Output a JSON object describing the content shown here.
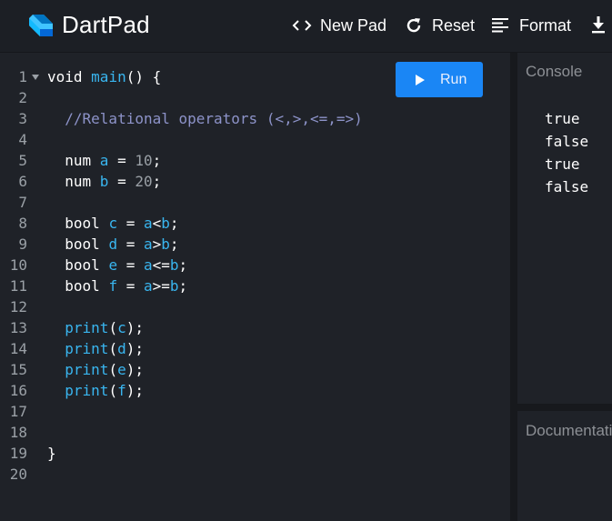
{
  "header": {
    "app_title": "DartPad",
    "toolbar": {
      "new_pad_label": "New Pad",
      "reset_label": "Reset",
      "format_label": "Format"
    }
  },
  "editor": {
    "run_label": "Run",
    "line_numbers": [
      "1",
      "2",
      "3",
      "4",
      "5",
      "6",
      "7",
      "8",
      "9",
      "10",
      "11",
      "12",
      "13",
      "14",
      "15",
      "16",
      "17",
      "18",
      "19",
      "20"
    ],
    "lines": [
      [
        {
          "t": "void ",
          "c": "kw"
        },
        {
          "t": "main",
          "c": "fn"
        },
        {
          "t": "() {",
          "c": "pl"
        }
      ],
      [],
      [
        {
          "t": "  //Relational operators (<,>,<=,=>)",
          "c": "cm"
        }
      ],
      [],
      [
        {
          "t": "  num ",
          "c": "kw"
        },
        {
          "t": "a",
          "c": "var"
        },
        {
          "t": " = ",
          "c": "pl"
        },
        {
          "t": "10",
          "c": "num"
        },
        {
          "t": ";",
          "c": "pl"
        }
      ],
      [
        {
          "t": "  num ",
          "c": "kw"
        },
        {
          "t": "b",
          "c": "var"
        },
        {
          "t": " = ",
          "c": "pl"
        },
        {
          "t": "20",
          "c": "num"
        },
        {
          "t": ";",
          "c": "pl"
        }
      ],
      [],
      [
        {
          "t": "  bool ",
          "c": "kw"
        },
        {
          "t": "c",
          "c": "var"
        },
        {
          "t": " = ",
          "c": "pl"
        },
        {
          "t": "a",
          "c": "var"
        },
        {
          "t": "<",
          "c": "pl"
        },
        {
          "t": "b",
          "c": "var"
        },
        {
          "t": ";",
          "c": "pl"
        }
      ],
      [
        {
          "t": "  bool ",
          "c": "kw"
        },
        {
          "t": "d",
          "c": "var"
        },
        {
          "t": " = ",
          "c": "pl"
        },
        {
          "t": "a",
          "c": "var"
        },
        {
          "t": ">",
          "c": "pl"
        },
        {
          "t": "b",
          "c": "var"
        },
        {
          "t": ";",
          "c": "pl"
        }
      ],
      [
        {
          "t": "  bool ",
          "c": "kw"
        },
        {
          "t": "e",
          "c": "var"
        },
        {
          "t": " = ",
          "c": "pl"
        },
        {
          "t": "a",
          "c": "var"
        },
        {
          "t": "<=",
          "c": "pl"
        },
        {
          "t": "b",
          "c": "var"
        },
        {
          "t": ";",
          "c": "pl"
        }
      ],
      [
        {
          "t": "  bool ",
          "c": "kw"
        },
        {
          "t": "f",
          "c": "var"
        },
        {
          "t": " = ",
          "c": "pl"
        },
        {
          "t": "a",
          "c": "var"
        },
        {
          "t": ">=",
          "c": "pl"
        },
        {
          "t": "b",
          "c": "var"
        },
        {
          "t": ";",
          "c": "pl"
        }
      ],
      [],
      [
        {
          "t": "  print",
          "c": "fn"
        },
        {
          "t": "(",
          "c": "pl"
        },
        {
          "t": "c",
          "c": "var"
        },
        {
          "t": ");",
          "c": "pl"
        }
      ],
      [
        {
          "t": "  print",
          "c": "fn"
        },
        {
          "t": "(",
          "c": "pl"
        },
        {
          "t": "d",
          "c": "var"
        },
        {
          "t": ");",
          "c": "pl"
        }
      ],
      [
        {
          "t": "  print",
          "c": "fn"
        },
        {
          "t": "(",
          "c": "pl"
        },
        {
          "t": "e",
          "c": "var"
        },
        {
          "t": ");",
          "c": "pl"
        }
      ],
      [
        {
          "t": "  print",
          "c": "fn"
        },
        {
          "t": "(",
          "c": "pl"
        },
        {
          "t": "f",
          "c": "var"
        },
        {
          "t": ");",
          "c": "pl"
        }
      ],
      [],
      [],
      [
        {
          "t": "}",
          "c": "pl"
        }
      ],
      []
    ]
  },
  "console": {
    "title": "Console",
    "output": [
      "true",
      "false",
      "true",
      "false"
    ]
  },
  "documentation": {
    "title": "Documentation"
  },
  "colors": {
    "background": "#1f2228",
    "header_bg": "#1c1f25",
    "run_button": "#1a86f5",
    "identifier": "#39b6f0",
    "comment": "#8d93c9",
    "number": "#9aa0a6"
  },
  "icons": {
    "logo": "dart-logo-icon",
    "new_pad": "code-brackets-icon",
    "reset": "refresh-icon",
    "format": "align-left-icon",
    "download": "download-icon",
    "run": "play-icon"
  }
}
